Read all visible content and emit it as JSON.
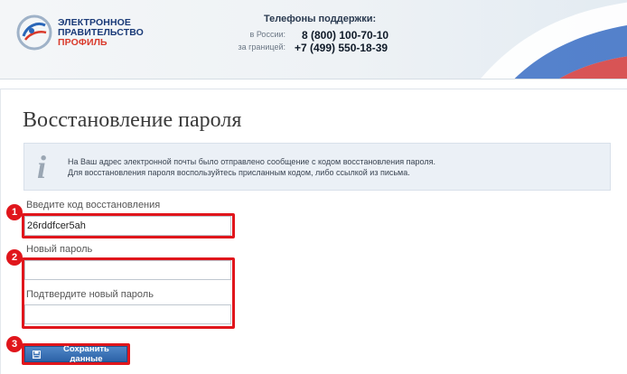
{
  "header": {
    "logo_lines": [
      "ЭЛЕКТРОННОЕ",
      "ПРАВИТЕЛЬСТВО",
      "ПРОФИЛЬ"
    ],
    "support_title": "Телефоны поддержки:",
    "russia_label": "в России:",
    "russia_phone": "8 (800) 100-70-10",
    "abroad_label": "за границей:",
    "abroad_phone": "+7 (499) 550-18-39"
  },
  "page": {
    "title": "Восстановление пароля"
  },
  "info": {
    "icon": "info-icon",
    "line1": "На Ваш адрес электронной почты было отправлено сообщение с кодом восстановления пароля.",
    "line2": "Для восстановления пароля воспользуйтесь присланным кодом, либо ссылкой из письма."
  },
  "form": {
    "code_label": "Введите код восстановления",
    "code_value": "26rddfcer5ah",
    "new_password_label": "Новый пароль",
    "new_password_value": "",
    "confirm_label": "Подтвердите новый пароль",
    "confirm_value": "",
    "save_label": "Сохранить данные"
  },
  "annotations": [
    "1",
    "2",
    "3"
  ],
  "colors": {
    "highlight": "#e0161c",
    "button": "#2c62a8",
    "brand_blue": "#1a3a78",
    "brand_red": "#d93a2b"
  }
}
